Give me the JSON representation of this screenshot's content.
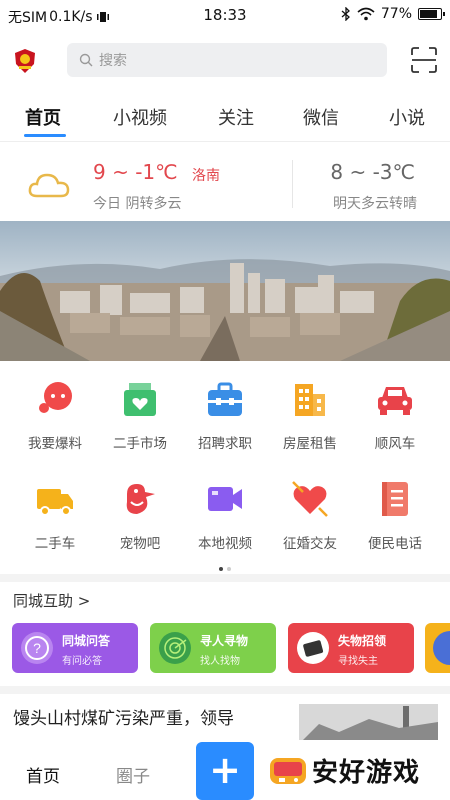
{
  "status_bar": {
    "carrier": "无SIM",
    "speed": "0.1K/s",
    "time": "18:33",
    "battery": "77%"
  },
  "search": {
    "placeholder": "搜索"
  },
  "tabs": [
    {
      "label": "首页",
      "active": true
    },
    {
      "label": "小视频"
    },
    {
      "label": "关注"
    },
    {
      "label": "微信"
    },
    {
      "label": "小说"
    }
  ],
  "weather": {
    "today_temp": "9 ~ -1℃",
    "city": "洛南",
    "today_desc": "今日 阴转多云",
    "tomorrow_temp": "8 ~ -3℃",
    "tomorrow_desc": "明天多云转晴"
  },
  "grid": [
    {
      "label": "我要爆料",
      "icon": "chat-bubble-icon",
      "color": "#f04a4a"
    },
    {
      "label": "二手市场",
      "icon": "market-bag-icon",
      "color": "#3fbf6f"
    },
    {
      "label": "招聘求职",
      "icon": "briefcase-icon",
      "color": "#3a8ee6"
    },
    {
      "label": "房屋租售",
      "icon": "building-icon",
      "color": "#f5a623"
    },
    {
      "label": "顺风车",
      "icon": "car-icon",
      "color": "#e8434a"
    },
    {
      "label": "二手车",
      "icon": "truck-icon",
      "color": "#f5b21b"
    },
    {
      "label": "宠物吧",
      "icon": "bird-icon",
      "color": "#e8434a"
    },
    {
      "label": "本地视频",
      "icon": "video-camera-icon",
      "color": "#8a5cf0"
    },
    {
      "label": "征婚交友",
      "icon": "heart-icon",
      "color": "#f04a4a"
    },
    {
      "label": "便民电话",
      "icon": "phonebook-icon",
      "color": "#f07a6a"
    }
  ],
  "help": {
    "title": "同城互助 >",
    "cards": [
      {
        "title": "同城问答",
        "subtitle": "有问必答",
        "color": "#9b59e6",
        "icon": "question-icon"
      },
      {
        "title": "寻人寻物",
        "subtitle": "找人找物",
        "color": "#7ed04b",
        "icon": "radar-icon"
      },
      {
        "title": "失物招领",
        "subtitle": "寻找失主",
        "color": "#e8434a",
        "icon": "wallet-icon"
      }
    ]
  },
  "news": {
    "title": "馒头山村煤矿污染严重，领导"
  },
  "bottom_nav": {
    "home": "首页",
    "circle": "圈子",
    "plus": "+"
  },
  "watermark": {
    "text": "安好游戏"
  }
}
